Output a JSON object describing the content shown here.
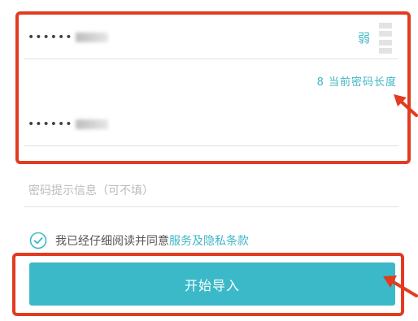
{
  "password_field": {
    "masked_value": "••••••"
  },
  "strength": {
    "label": "弱"
  },
  "length_hint": {
    "text": "8 当前密码长度"
  },
  "confirm_field": {
    "masked_value": "••••••"
  },
  "hint_field": {
    "placeholder": "密码提示信息（可不填）"
  },
  "agreement": {
    "prefix": "我已经仔细阅读并同意",
    "link": "服务及隐私条款",
    "checked": true
  },
  "start_button": {
    "label": "开始导入"
  },
  "colors": {
    "accent": "#3bb9c8",
    "annotation": "#e23b1f"
  }
}
